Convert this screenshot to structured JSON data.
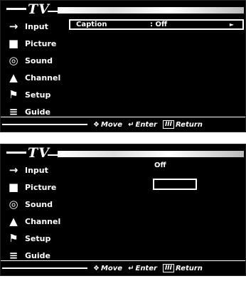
{
  "screens": [
    {
      "title": "TV",
      "menu": [
        {
          "label": "Input",
          "icon": "input-icon",
          "glyph": "→"
        },
        {
          "label": "Picture",
          "icon": "picture-icon",
          "glyph": "■"
        },
        {
          "label": "Sound",
          "icon": "sound-icon",
          "glyph": "◎"
        },
        {
          "label": "Channel",
          "icon": "channel-icon",
          "glyph": "▲"
        },
        {
          "label": "Setup",
          "icon": "setup-icon",
          "glyph": "⚑"
        },
        {
          "label": "Guide",
          "icon": "guide-icon",
          "glyph": "≡"
        }
      ],
      "selected_row": {
        "label": "Caption",
        "value": ": Off",
        "arrow": "►"
      },
      "footer": {
        "move": "Move",
        "enter": "Enter",
        "return": "Return"
      }
    },
    {
      "title": "TV",
      "menu": [
        {
          "label": "Input",
          "icon": "input-icon",
          "glyph": "→"
        },
        {
          "label": "Picture",
          "icon": "picture-icon",
          "glyph": "■"
        },
        {
          "label": "Sound",
          "icon": "sound-icon",
          "glyph": "◎"
        },
        {
          "label": "Channel",
          "icon": "channel-icon",
          "glyph": "▲"
        },
        {
          "label": "Setup",
          "icon": "setup-icon",
          "glyph": "⚑"
        },
        {
          "label": "Guide",
          "icon": "guide-icon",
          "glyph": "≡"
        }
      ],
      "option_value": "Off",
      "footer": {
        "move": "Move",
        "enter": "Enter",
        "return": "Return"
      }
    }
  ]
}
